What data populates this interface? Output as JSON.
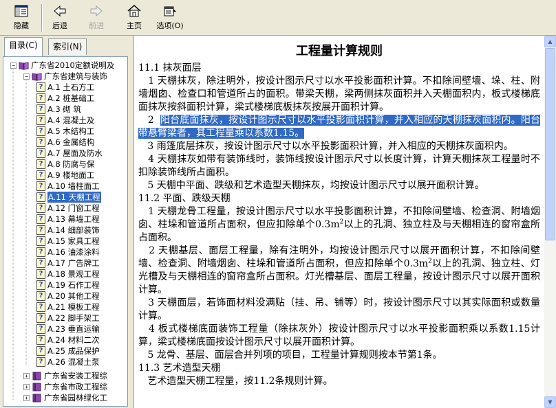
{
  "toolbar": {
    "hide": "隐藏",
    "back": "后退",
    "forward": "前进",
    "home": "主页",
    "options": "选项(O)"
  },
  "tabs": {
    "contents": "目录(C)",
    "index": "索引(N)"
  },
  "tree": {
    "root": "广东省2010定额说明及",
    "chapter": "广东省建筑与装饰",
    "items": [
      "A.1  土石方工",
      "A.2  桩基础工",
      "A.3  砌  筑",
      "A.4  混凝土及",
      "A.5  木结构工",
      "A.6  金属结构",
      "A.7  屋面及防水",
      "A.8  防腐与保",
      "A.9  楼地面工",
      "A.10  墙柱面工",
      "A.11  天棚工程",
      "A.12  门窗工程",
      "A.13  幕墙工程",
      "A.14  细部装饰",
      "A.15  家具工程",
      "A.16  油漆涂料",
      "A.17  广告牌工",
      "A.18  景观工程",
      "A.19  石作工程",
      "A.20  其他工程",
      "A.21  模板工程",
      "A.22  脚手架工",
      "A.23  垂直运输",
      "A.24  材料二次",
      "A.25  成品保护",
      "A.26  混凝土泵"
    ],
    "selected_index": 10,
    "others": [
      "广东省安装工程综",
      "广东省市政工程综",
      "广东省园林绿化工"
    ]
  },
  "document": {
    "title": "工程量计算规则",
    "p1": "11.1  抹灰面层",
    "p2": "1  天棚抹灰，除注明外，按设计图示尺寸以水平投影面积计算。不扣除间壁墙、垛、柱、附墙烟囱、检查口和管道所占的面积。带梁天棚，梁两侧抹灰面积并入天棚面积内，板式楼梯底面抹灰按斜面积计算，梁式楼梯底板抹灰按展开面积计算。",
    "p3_prefix": "2",
    "p3_highlight": "阳台底面抹灰，按设计图示尺寸以水平投影面积计算，并入相应的天棚抹灰面积内。阳台带悬臂梁者，其工程量乘以系数1.15。",
    "p4": "3  雨篷底层抹灰，按设计图示尺寸以水平投影面积计算，并入相应的天棚抹灰面积内。",
    "p5": "4  天棚抹灰如带有装饰线时，装饰线按设计图示尺寸以长度计算，计算天棚抹灰工程量时不扣除装饰线所占面积。",
    "p6": "5  天棚中平面、跌级和艺术造型天棚抹灰，均按设计图示尺寸以展开面积计算。",
    "p7": "11.2  平面、跌级天棚",
    "p8a": "1  天棚龙骨工程量，按设计图示尺寸以水平投影面积计算，不扣除间壁墙、检查洞、附墙烟囱、柱垛和管道所占面积，但应扣除单个0.3m",
    "p8b": "以上的孔洞、独立柱及与天棚相连的窗帘盒所占面积。",
    "p9a": "2  天棚基层、面层工程量，除有注明外，均按设计图示尺寸以展开面积计算，不扣除间壁墙、检查洞、附墙烟囱、柱垛和管道所占面积，但应扣除单个0.3m",
    "p9b": "以上的孔洞、独立柱、灯光槽及与天棚相连的窗帘盒所占面积。灯光槽基层、面层工程量，按设计图示尺寸以展开面积计算。",
    "sup": "2",
    "p10": "3  天棚面层，若饰面材料没满贴（挂、吊、铺等）时，按设计图示尺寸以其实际面积或数量计算。",
    "p11": "4  板式楼梯底面装饰工程量（除抹灰外）按设计图示尺寸以水平投影面积乘以系数1.15计算，梁式楼梯底面按设计图示尺寸以展开面积计算。",
    "p12": "5  龙骨、基层、面层合并列项的项目，工程量计算规则按本节第1条。",
    "p13": "11.3  艺术造型天棚",
    "p14": "艺术造型天棚工程量，按11.2条规则计算。"
  },
  "colors": {
    "selection": "#316ac5",
    "chrome": "#ece9d8",
    "scrollbar": "#c1d3fb"
  }
}
